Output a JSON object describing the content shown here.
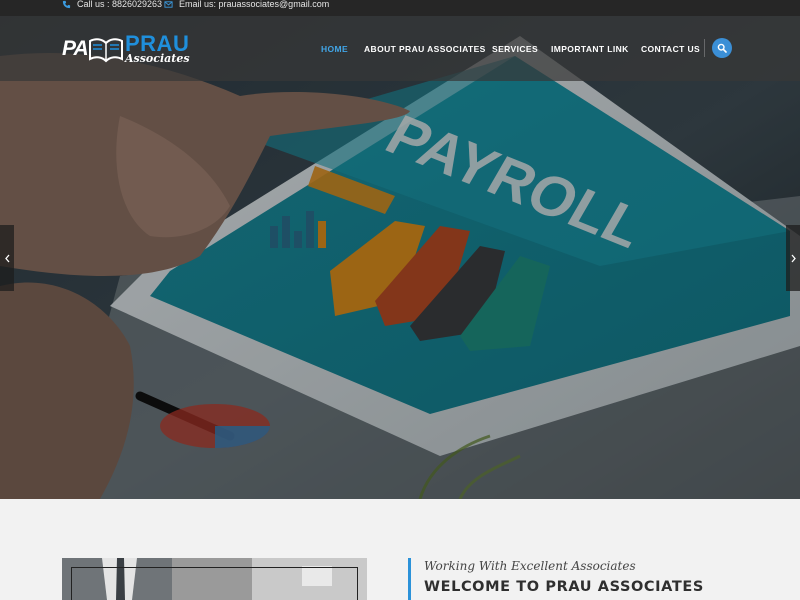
{
  "topbar": {
    "phone_text": "Call us : 8826029263",
    "email_text": "Email us: prauassociates@gmail.com"
  },
  "logo": {
    "monogram": "PA",
    "name": "PRAU",
    "tagline": "Associates"
  },
  "nav": {
    "items": [
      {
        "label": "HOME",
        "active": true
      },
      {
        "label": "ABOUT PRAU ASSOCIATES",
        "active": false
      },
      {
        "label": "SERVICES",
        "active": false
      },
      {
        "label": "IMPORTANT LINK",
        "active": false
      },
      {
        "label": "CONTACT US",
        "active": false
      }
    ]
  },
  "hero": {
    "screen_text": "PAYROLL"
  },
  "about": {
    "subtitle": "Working With Excellent Associates",
    "title": "WELCOME TO PRAU ASSOCIATES"
  },
  "colors": {
    "accent": "#41a5e6",
    "brand_blue": "#1f8fdc",
    "topbar_bg": "#262626"
  }
}
